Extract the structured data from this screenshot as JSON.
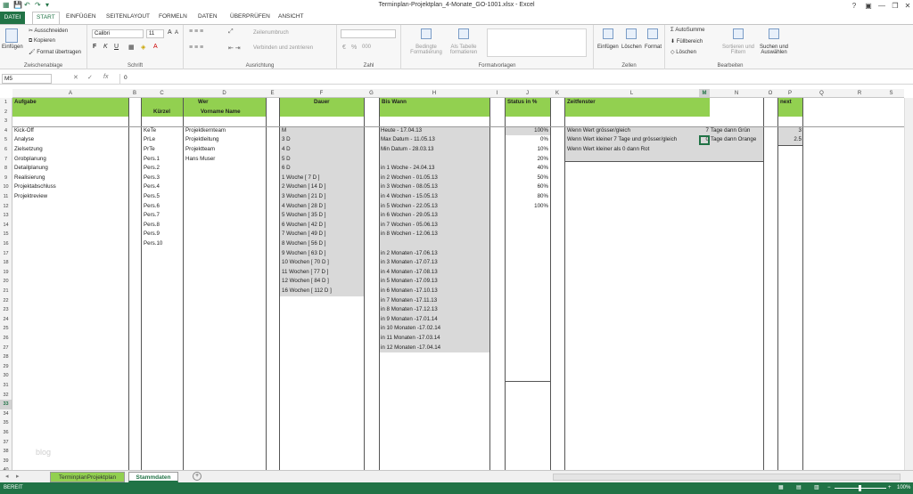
{
  "window": {
    "title": "Terminplan-Projektplan_4-Monate_GO-1001.xlsx - Excel",
    "help": "?",
    "minimize": "—",
    "restore": "❐",
    "close": "✕",
    "ribbon_toggle": "▣"
  },
  "qat": {
    "save": "💾",
    "undo": "↶",
    "redo": "↷",
    "more": "▾"
  },
  "tabs": [
    "DATEI",
    "START",
    "EINFÜGEN",
    "SEITENLAYOUT",
    "FORMELN",
    "DATEN",
    "ÜBERPRÜFEN",
    "ANSICHT"
  ],
  "ribbon": {
    "clipboard": {
      "paste": "Einfügen",
      "cut": "Ausschneiden",
      "copy": "Kopieren",
      "format": "Format übertragen",
      "label": "Zwischenablage"
    },
    "font": {
      "name": "Calibri",
      "size": "11",
      "grow": "A",
      "shrink": "A",
      "bold": "F",
      "italic": "K",
      "underline": "U",
      "label": "Schrift"
    },
    "align": {
      "wrap": "Zeilenumbruch",
      "merge": "Verbinden und zentrieren",
      "label": "Ausrichtung"
    },
    "number": {
      "format": "",
      "pct": "%",
      "thousands": "000",
      "label": "Zahl"
    },
    "styles": {
      "cond": "Bedingte Formatierung",
      "table": "Als Tabelle formatieren",
      "label": "Formatvorlagen"
    },
    "cells": {
      "insert": "Einfügen",
      "delete": "Löschen",
      "format": "Format",
      "label": "Zellen"
    },
    "edit": {
      "autosum": "AutoSumme",
      "fill": "Füllbereich",
      "clear": "Löschen",
      "sort": "Sortieren und Filtern",
      "find": "Suchen und Auswählen",
      "label": "Bearbeiten"
    }
  },
  "formula_bar": {
    "namebox": "M5",
    "cancel": "✕",
    "enter": "✓",
    "fx": "fx",
    "value": "0"
  },
  "columns": [
    "A",
    "B",
    "C",
    "D",
    "E",
    "F",
    "G",
    "H",
    "I",
    "J",
    "K",
    "L",
    "M",
    "N",
    "O",
    "P",
    "Q",
    "R",
    "S"
  ],
  "headers": {
    "aufgabe": "Aufgabe",
    "wer": "Wer",
    "kurzel": "Kürzel",
    "vorname": "Vorname Name",
    "dauer": "Dauer",
    "bis_wann": "Bis Wann",
    "status": "Status in %",
    "zeitfenster": "Zeitfenster",
    "next": "next"
  },
  "aufgaben": [
    "Kick-Off",
    "Analyse",
    "Zielsetzung",
    "Grobplanung",
    "Detailplanung",
    "Realisierung",
    "Projektabschluss",
    "Projektreview"
  ],
  "kurzel": [
    "KeTe",
    "PrLe",
    "PrTe",
    "Pers.1",
    "Pers.2",
    "Pers.3",
    "Pers.4",
    "Pers.5",
    "Pers.6",
    "Pers.7",
    "Pers.8",
    "Pers.9",
    "Pers.10"
  ],
  "namen": [
    "Projektkernteam",
    "Projektleitung",
    "Projektteam",
    "Hans Muser"
  ],
  "dauer": [
    "M",
    "3 D",
    "4 D",
    "5 D",
    "6 D",
    "1 Woche [ 7 D ]",
    "2 Wochen [ 14 D ]",
    "3 Wochen [ 21 D ]",
    "4 Wochen [ 28 D ]",
    "5 Wochen [ 35 D ]",
    "6 Wochen [ 42 D ]",
    "7 Wochen [ 49 D ]",
    "8 Wochen [ 56 D ]",
    "9 Wochen [ 63 D ]",
    "10 Wochen [ 70 D ]",
    "11 Wochen [ 77 D ]",
    "12 Wochen [ 84 D ]",
    "16 Wochen [ 112 D ]"
  ],
  "bis_wann": [
    "Heute  - 17.04.13",
    "Max Datum  - 11.05.13",
    "Min Datum  - 28.03.13",
    "",
    "in 1 Woche  - 24.04.13",
    "in 2 Wochen - 01.05.13",
    "in 3 Wochen - 08.05.13",
    "in 4 Wochen - 15.05.13",
    "in 5 Wochen - 22.05.13",
    "in 6 Wochen - 29.05.13",
    "in 7 Wochen - 05.06.13",
    "in 8 Wochen - 12.06.13",
    "",
    "in 2 Monaten -17.06.13",
    "in 3 Monaten -17.07.13",
    "in 4 Monaten -17.08.13",
    "in 5 Monaten -17.09.13",
    "in 6 Monaten -17.10.13",
    "in 7 Monaten -17.11.13",
    "in 8 Monaten -17.12.13",
    "in 9 Monaten -17.01.14",
    "in 10 Monaten -17.02.14",
    "in 11 Monaten -17.03.14",
    "in 12 Monaten -17.04.14"
  ],
  "status": [
    "100%",
    "0%",
    "10%",
    "20%",
    "40%",
    "50%",
    "60%",
    "80%",
    "100%"
  ],
  "zeitfenster": [
    {
      "text": "Wenn Wert grösser/gleich",
      "m": "7",
      "n": "Tage dann Grün"
    },
    {
      "text": "Wenn Wert kleiner 7 Tage und grösser/gleich",
      "m": "0",
      "n": "Tage dann Orange"
    },
    {
      "text": "Wenn Wert kleiner als 0 dann Rot",
      "m": "",
      "n": ""
    }
  ],
  "next": [
    "3",
    "2.5"
  ],
  "sheet_tabs": [
    "TerminplanProjektplan",
    "Stammdaten"
  ],
  "add_sheet": "+",
  "status_bar": {
    "ready": "BEREIT",
    "zoom": "100%",
    "minus": "−",
    "plus": "+"
  },
  "watermark": "blog"
}
